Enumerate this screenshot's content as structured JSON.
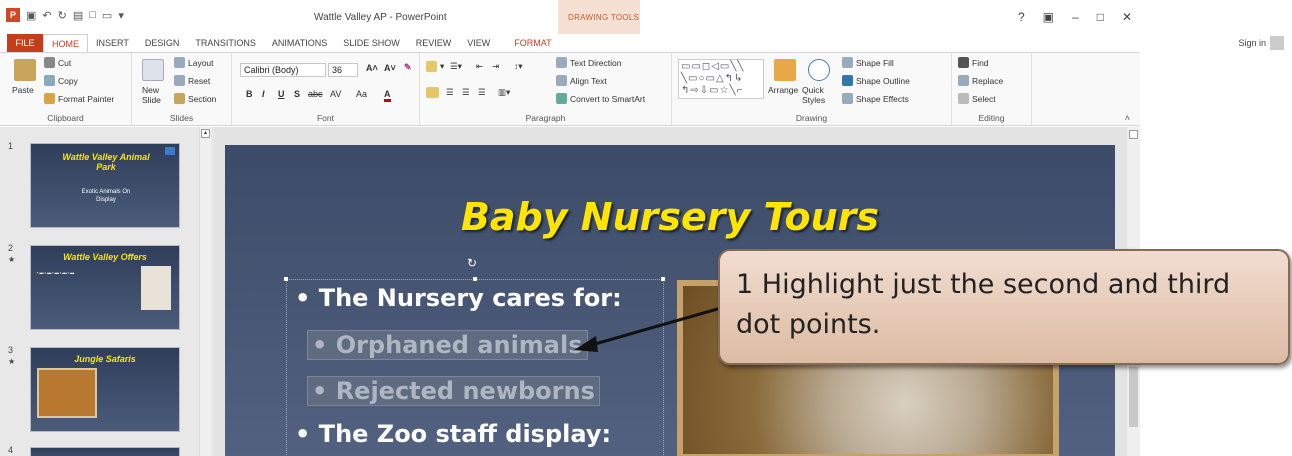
{
  "window": {
    "title": "Wattle Valley AP - PowerPoint",
    "contextual_tab_group": "DRAWING TOOLS",
    "controls": [
      "?",
      "▣",
      "–",
      "□",
      "✕"
    ],
    "signin": "Sign in"
  },
  "tabs": [
    "FILE",
    "HOME",
    "INSERT",
    "DESIGN",
    "TRANSITIONS",
    "ANIMATIONS",
    "SLIDE SHOW",
    "REVIEW",
    "VIEW"
  ],
  "format_tab": "FORMAT",
  "ribbon": {
    "clipboard": {
      "label": "Clipboard",
      "paste": "Paste",
      "cut": "Cut",
      "copy": "Copy",
      "format_painter": "Format Painter"
    },
    "slides": {
      "label": "Slides",
      "new_slide": "New Slide",
      "layout": "Layout",
      "reset": "Reset",
      "section": "Section"
    },
    "font": {
      "label": "Font",
      "name": "Calibri (Body)",
      "size": "36",
      "buttons": [
        "B",
        "I",
        "U",
        "S",
        "abc",
        "AV",
        "Aa",
        "A"
      ]
    },
    "paragraph": {
      "label": "Paragraph",
      "text_direction": "Text Direction",
      "align_text": "Align Text",
      "smartart": "Convert to SmartArt"
    },
    "drawing": {
      "label": "Drawing",
      "arrange": "Arrange",
      "quick_styles": "Quick Styles",
      "shape_fill": "Shape Fill",
      "shape_outline": "Shape Outline",
      "shape_effects": "Shape Effects"
    },
    "editing": {
      "label": "Editing",
      "find": "Find",
      "replace": "Replace",
      "select": "Select"
    }
  },
  "thumbnails": [
    {
      "num": "1",
      "title": "Wattle Valley Animal Park",
      "sub": "Exotic Animals On Display"
    },
    {
      "num": "2",
      "title": "Wattle Valley Offers"
    },
    {
      "num": "3",
      "title": "Jungle Safaris"
    },
    {
      "num": "4"
    }
  ],
  "slide": {
    "title": "Baby Nursery Tours",
    "bullets": [
      "• The Nursery cares for:",
      "• Orphaned animals",
      "• Rejected newborns",
      "• The Zoo staff display:"
    ]
  },
  "callout": {
    "text": "1  Highlight just the second and third dot points."
  }
}
